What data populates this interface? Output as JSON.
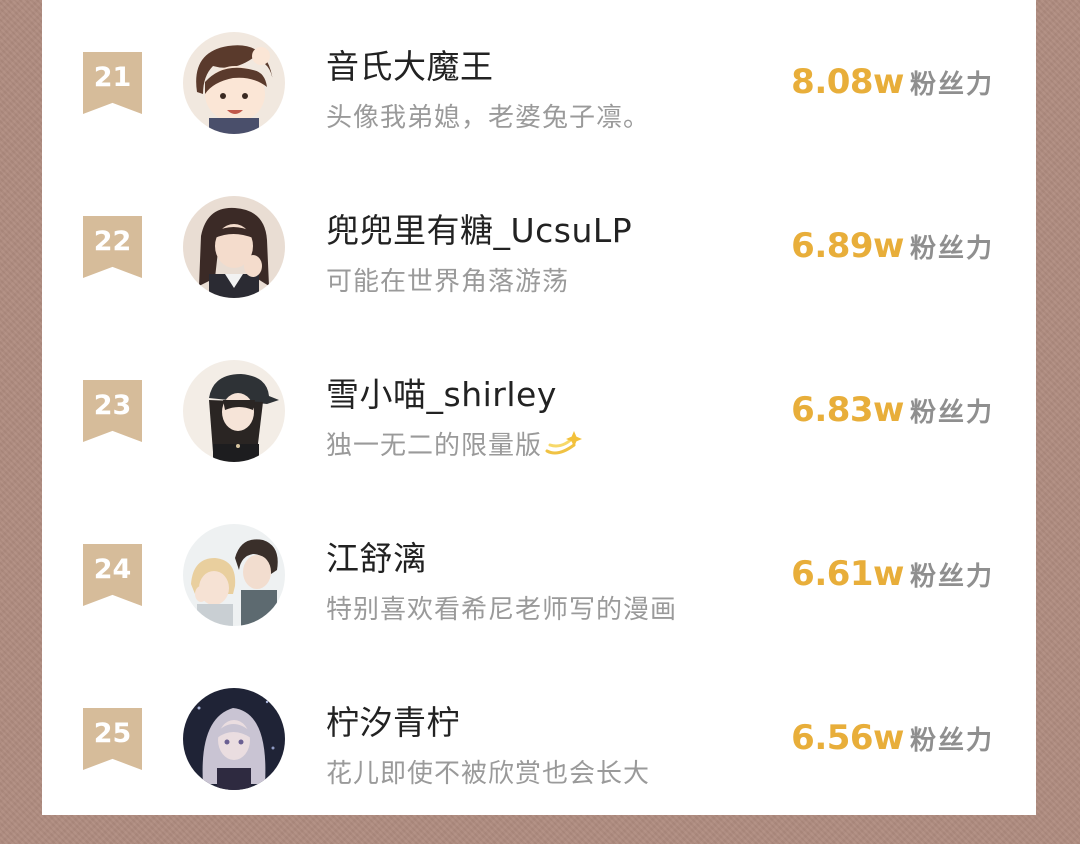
{
  "colors": {
    "accent": "#e8ae3a",
    "rank_badge": "#d6bc9a",
    "background": "#b08c80"
  },
  "fans_label": "粉丝力",
  "rows": [
    {
      "rank": "21",
      "name": "音氏大魔王",
      "bio": "头像我弟媳，老婆兔子凛。",
      "fans": "8.08w",
      "avatar": "cartoon-boy-avatar"
    },
    {
      "rank": "22",
      "name": "兜兜里有糖_UcsuLP",
      "bio": "可能在世界角落游荡",
      "fans": "6.89w",
      "avatar": "girl-photo-avatar"
    },
    {
      "rank": "23",
      "name": "雪小喵_shirley",
      "bio": "独一无二的限量版",
      "bio_icon": "dizzy-sparkle-icon",
      "fans": "6.83w",
      "avatar": "girl-cap-avatar"
    },
    {
      "rank": "24",
      "name": "江舒漓",
      "bio": "特别喜欢看希尼老师写的漫画",
      "fans": "6.61w",
      "avatar": "anime-couple-avatar"
    },
    {
      "rank": "25",
      "name": "柠汐青柠",
      "bio": "花儿即使不被欣赏也会长大",
      "fans": "6.56w",
      "avatar": "anime-girl-avatar"
    }
  ]
}
